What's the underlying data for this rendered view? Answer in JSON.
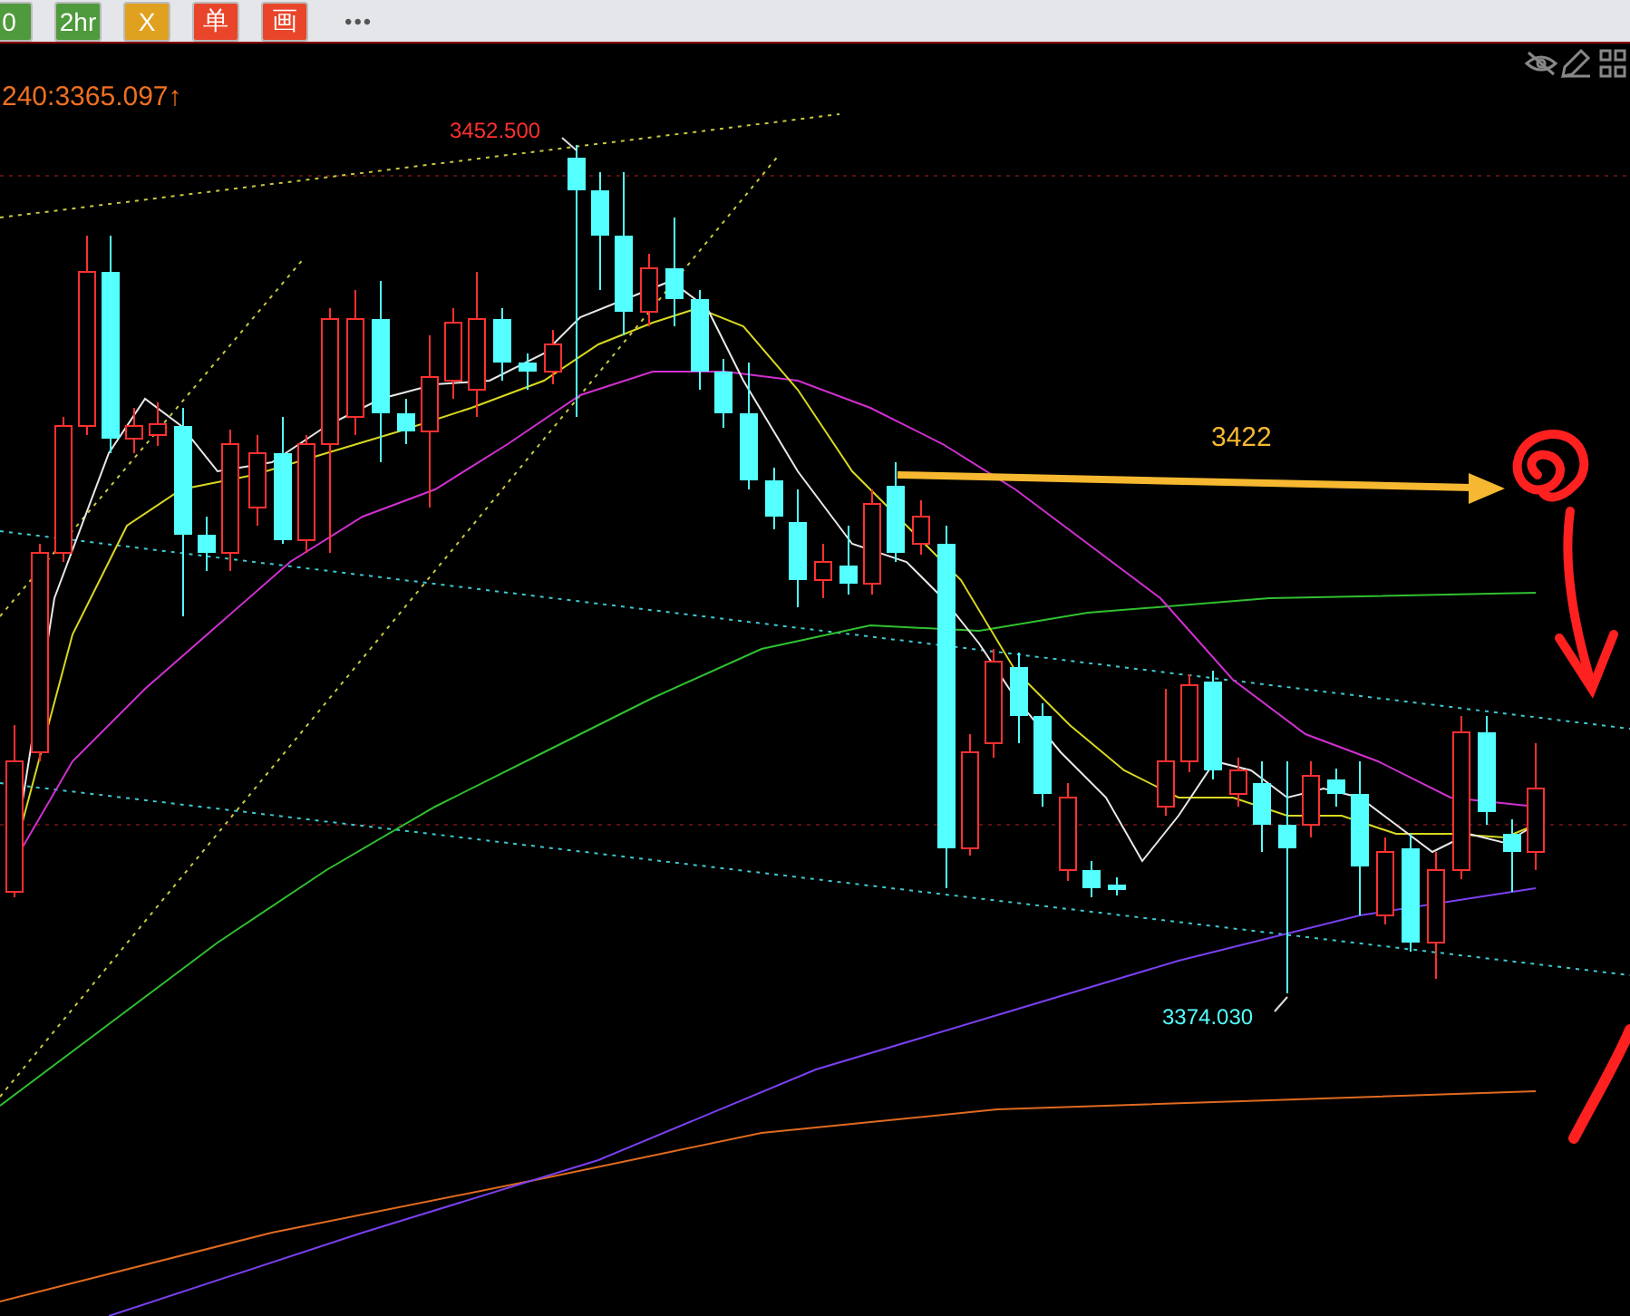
{
  "toolbar": {
    "buttons": [
      {
        "label": "0",
        "color": "#4e9a3c"
      },
      {
        "label": "2hr",
        "color": "#4e9a3c"
      },
      {
        "label": "X",
        "color": "#e0a020"
      },
      {
        "label": "单",
        "color": "#e8452a"
      },
      {
        "label": "画",
        "color": "#e8452a"
      }
    ],
    "more": "•••"
  },
  "chart": {
    "indicator_label": "240:3365.097↑",
    "high_label": "3452.500",
    "low_label": "3374.030",
    "target_label": "3422"
  }
}
